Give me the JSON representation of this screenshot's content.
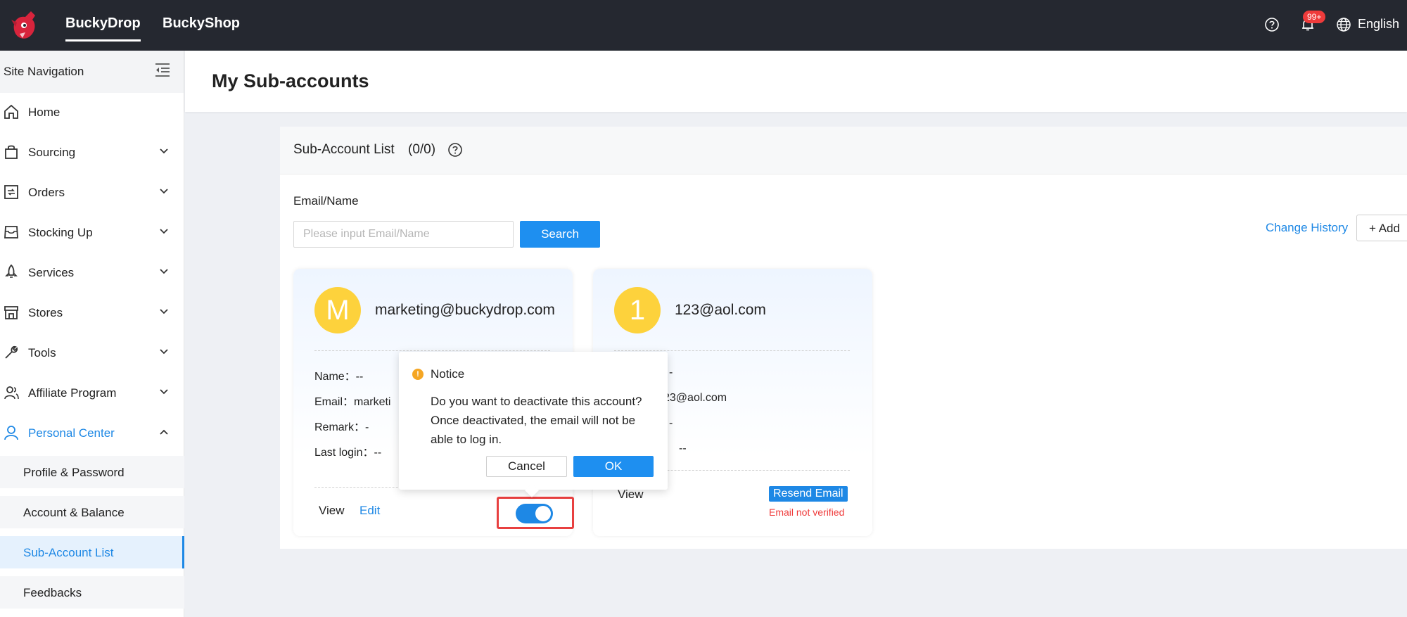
{
  "topbar": {
    "tabs": [
      {
        "label": "BuckyDrop",
        "active": true
      },
      {
        "label": "BuckyShop",
        "active": false
      }
    ],
    "notification_badge": "99+",
    "language": "English"
  },
  "sidebar": {
    "header": "Site Navigation",
    "items": [
      {
        "label": "Home",
        "icon": "home-icon"
      },
      {
        "label": "Sourcing",
        "icon": "bag-icon"
      },
      {
        "label": "Orders",
        "icon": "orders-icon"
      },
      {
        "label": "Stocking Up",
        "icon": "inbox-icon"
      },
      {
        "label": "Services",
        "icon": "rocket-icon"
      },
      {
        "label": "Stores",
        "icon": "store-icon"
      },
      {
        "label": "Tools",
        "icon": "wrench-icon"
      },
      {
        "label": "Affiliate Program",
        "icon": "users-icon"
      },
      {
        "label": "Personal Center",
        "icon": "user-icon",
        "active": true
      }
    ],
    "sub_items": [
      {
        "label": "Profile & Password"
      },
      {
        "label": "Account & Balance"
      },
      {
        "label": "Sub-Account List",
        "selected": true
      },
      {
        "label": "Feedbacks"
      }
    ]
  },
  "page": {
    "title": "My Sub-accounts"
  },
  "panel": {
    "title": "Sub-Account List",
    "count": "(0/0)",
    "filter_label": "Email/Name",
    "search_placeholder": "Please input Email/Name",
    "search_button": "Search",
    "change_history": "Change History",
    "add_button": "+ Add"
  },
  "cards": [
    {
      "avatar_letter": "M",
      "email": "marketing@buckydrop.com",
      "name_line": "Name：--",
      "email_line": "Email：marketi",
      "remark_line": "Remark：-",
      "last_login_line": "Last login：--",
      "view": "View",
      "edit": "Edit",
      "toggle_on": true
    },
    {
      "avatar_letter": "1",
      "email": "123@aol.com",
      "name_line": "-",
      "email_line": "23@aol.com",
      "remark_line": "-",
      "last_login_line": "--",
      "view": "View",
      "resend_email": "Resend Email",
      "status": "Email not verified"
    }
  ],
  "popconfirm": {
    "title": "Notice",
    "message": "Do you want to deactivate this account? Once deactivated, the email will not be able to log in.",
    "cancel": "Cancel",
    "ok": "OK"
  },
  "colors": {
    "accent": "#1e88e5",
    "topbar": "#252830",
    "avatar": "#fdd23c",
    "danger": "#e84040",
    "warning": "#f5a623"
  }
}
